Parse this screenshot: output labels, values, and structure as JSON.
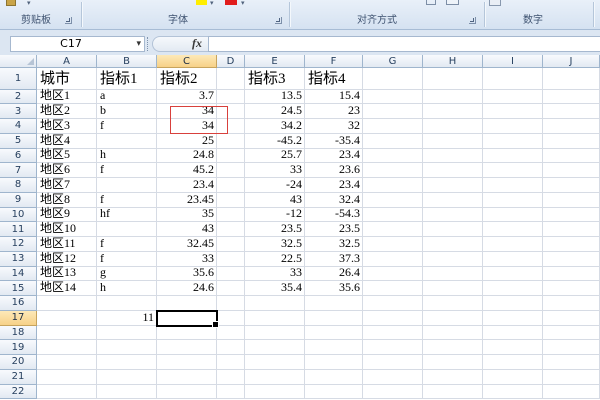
{
  "ribbon": {
    "groups": [
      {
        "label": "剪贴板"
      },
      {
        "label": "字体"
      },
      {
        "label": "对齐方式"
      },
      {
        "label": "数字"
      }
    ]
  },
  "icons": [
    "format-painter-icon",
    "highlight-color-icon",
    "font-color-icon",
    "wrap-text-icon",
    "merge-cells-icon",
    "number-format-icon",
    "dialog-launcher-icon",
    "chevron-down-icon"
  ],
  "formula_bar": {
    "name_box": "C17",
    "fx_label": "fx",
    "value": ""
  },
  "sheet": {
    "columns": [
      "A",
      "B",
      "C",
      "D",
      "E",
      "F",
      "G",
      "H",
      "I",
      "J"
    ],
    "row_numbers": [
      "1",
      "2",
      "3",
      "4",
      "5",
      "6",
      "7",
      "8",
      "9",
      "10",
      "11",
      "12",
      "13",
      "14",
      "15",
      "16",
      "17",
      "18",
      "19",
      "20",
      "21",
      "22"
    ],
    "rows": [
      [
        "城市",
        "指标1",
        "指标2",
        "",
        "指标3",
        "指标4"
      ],
      [
        "地区1",
        "a",
        "3.7",
        "",
        "13.5",
        "15.4"
      ],
      [
        "地区2",
        "b",
        "34",
        "",
        "24.5",
        "23"
      ],
      [
        "地区3",
        "f",
        "34",
        "",
        "34.2",
        "32"
      ],
      [
        "地区4",
        "",
        "25",
        "",
        "-45.2",
        "-35.4"
      ],
      [
        "地区5",
        "h",
        "24.8",
        "",
        "25.7",
        "23.4"
      ],
      [
        "地区6",
        "f",
        "45.2",
        "",
        "33",
        "23.6"
      ],
      [
        "地区7",
        "",
        "23.4",
        "",
        "-24",
        "23.4"
      ],
      [
        "地区8",
        "f",
        "23.45",
        "",
        "43",
        "32.4"
      ],
      [
        "地区9",
        "hf",
        "35",
        "",
        "-12",
        "-54.3"
      ],
      [
        "地区10",
        "",
        "43",
        "",
        "23.5",
        "23.5"
      ],
      [
        "地区11",
        "f",
        "32.45",
        "",
        "32.5",
        "32.5"
      ],
      [
        "地区12",
        "f",
        "33",
        "",
        "22.5",
        "37.3"
      ],
      [
        "地区13",
        "g",
        "35.6",
        "",
        "33",
        "26.4"
      ],
      [
        "地区14",
        "h",
        "24.6",
        "",
        "35.4",
        "35.6"
      ],
      [],
      [
        "",
        "11"
      ],
      [],
      [],
      [],
      [],
      []
    ]
  },
  "colors": {
    "annot": "#d8403c",
    "active-hdr": "#f7d188",
    "gridline": "#d6dbe4",
    "hdr-border": "#9fb5cd",
    "selection": "#000000",
    "highlight": "#ffee00",
    "fontcolor": "#e11c1c"
  }
}
